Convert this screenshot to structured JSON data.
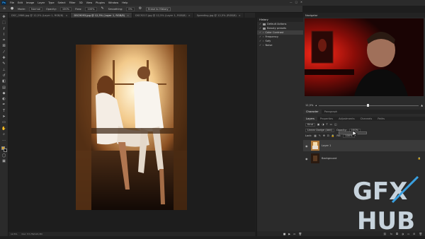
{
  "app": {
    "logo": "Ps"
  },
  "menu": [
    "File",
    "Edit",
    "Image",
    "Layer",
    "Type",
    "Select",
    "Filter",
    "3D",
    "View",
    "Plugins",
    "Window",
    "Help"
  ],
  "window_controls": [
    "—",
    "□",
    "✕"
  ],
  "options_bar": {
    "mode_label": "Mode:",
    "mode_value": "Normal",
    "opacity_label": "Opacity:",
    "opacity_value": "100%",
    "flow_label": "Flow:",
    "flow_value": "100%",
    "smoothing_label": "Smoothing:",
    "smoothing_value": "0%",
    "erase_history": "Erase to History"
  },
  "doc_tabs": [
    {
      "title": "DSC_0986.jpg @ 12,5% (Layer 1, RGB/8)",
      "active": false
    },
    {
      "title": "DSC9093.jpg @ 12,5% (Layer 1, RGB/8)",
      "active": true
    },
    {
      "title": "DSC9217.jpg @ 12,5% (Layer 1, RGB/8)",
      "active": false
    },
    {
      "title": "Speeding.jpg @ 12,5% (RGB/8)",
      "active": false
    }
  ],
  "tools": [
    "move",
    "marquee",
    "lasso",
    "quick-select",
    "crop",
    "frame",
    "eyedropper",
    "healing",
    "brush",
    "stamp",
    "history-brush",
    "eraser",
    "gradient",
    "blur",
    "dodge",
    "pen",
    "type",
    "path-select",
    "rectangle",
    "hand",
    "zoom",
    "more"
  ],
  "colors": {
    "foreground": "#d8a42f",
    "background": "#111111",
    "accent": "#31a8ff"
  },
  "status": {
    "zoom": "12,5%",
    "doc": "Doc: 57,7M/115,3M"
  },
  "history": {
    "title": "History",
    "items": [
      {
        "label": "Default Actions",
        "type": "folder"
      },
      {
        "label": "Beauty presets",
        "type": "folder"
      },
      {
        "label": "Color Contrast",
        "type": "action",
        "selected": true
      },
      {
        "label": "Frequency",
        "type": "action"
      },
      {
        "label": "Sofy",
        "type": "action"
      },
      {
        "label": "Noise",
        "type": "action"
      }
    ]
  },
  "navigator": {
    "title": "Navigator",
    "zoom": "12,5%"
  },
  "char_tabs": [
    "Character",
    "Paragraph"
  ],
  "layers_tabs": [
    "Layers",
    "Properties",
    "Adjustments",
    "Channels",
    "Paths"
  ],
  "layers": {
    "kind": "Kind",
    "blend_mode": "Linear Dodge (Add)",
    "opacity_label": "Opacity:",
    "opacity_value": "100%",
    "lock_label": "Lock:",
    "fill_label": "Fill:",
    "fill_value": "100%",
    "items": [
      {
        "name": "Layer 1",
        "selected": true
      },
      {
        "name": "Background",
        "selected": false
      }
    ]
  },
  "watermark": {
    "top": "GFX",
    "bottom": "HUB"
  }
}
